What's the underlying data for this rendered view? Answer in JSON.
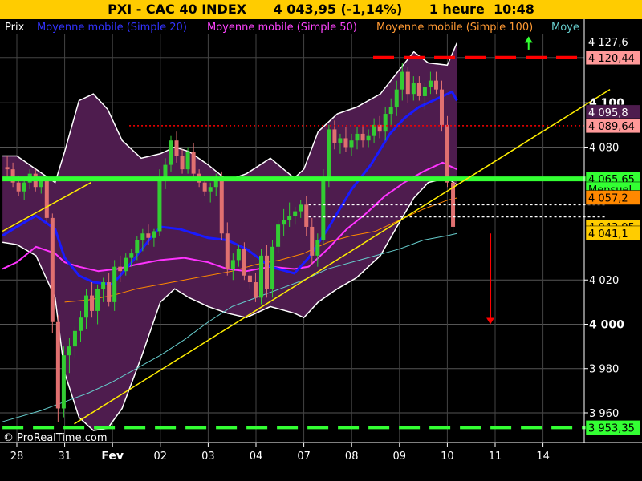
{
  "title": "PXI - CAC 40 INDEX      4 043,95 (-1,14%)      1 heure  10:48",
  "legend": {
    "prix": "Prix",
    "ma20": "Moyenne mobile (Simple 20)",
    "ma50": "Moyenne mobile (Simple 50)",
    "ma100": "Moyenne mobile (Simple 100)",
    "ma_cut": "Moye"
  },
  "watermark": "© ProRealTime.com",
  "colors": {
    "background": "#000000",
    "title_bg": "#ffcc00",
    "bollinger_fill": "#4e1c4e",
    "bollinger_edge": "#ffffff",
    "up_candle": "#33cc33",
    "down_candle": "#e07070",
    "ma20": "#1a1aff",
    "ma50": "#ff33ff",
    "ma100": "#ff8800",
    "ma200": "#66cccc",
    "trendline": "#ffee00",
    "support": "#33ff33",
    "resistance": "#ff0000"
  },
  "chart_data": {
    "type": "candlestick",
    "timeframe": "1 heure",
    "instrument": "PXI - CAC 40 INDEX",
    "last": "4 043,95",
    "change": "-1,14%",
    "ylim": [
      3951,
      4133
    ],
    "y_ticks": [
      {
        "label": "3 960",
        "value": 3960,
        "bold": false
      },
      {
        "label": "3 980",
        "value": 3980,
        "bold": false
      },
      {
        "label": "4 000",
        "value": 4000,
        "bold": true
      },
      {
        "label": "4 020",
        "value": 4020,
        "bold": false
      },
      {
        "label": "4 080",
        "value": 4080,
        "bold": false
      },
      {
        "label": "4 100",
        "value": 4100,
        "bold": true
      }
    ],
    "x_labels": [
      {
        "label": "28",
        "pos": 0,
        "bold": false
      },
      {
        "label": "31",
        "pos": 1,
        "bold": false
      },
      {
        "label": "Fev",
        "pos": 2,
        "bold": true
      },
      {
        "label": "02",
        "pos": 3,
        "bold": false
      },
      {
        "label": "03",
        "pos": 4,
        "bold": false
      },
      {
        "label": "04",
        "pos": 5,
        "bold": false
      },
      {
        "label": "07",
        "pos": 6,
        "bold": false
      },
      {
        "label": "08",
        "pos": 7,
        "bold": false
      },
      {
        "label": "09",
        "pos": 8,
        "bold": false
      },
      {
        "label": "10",
        "pos": 9,
        "bold": false
      },
      {
        "label": "11",
        "pos": 10,
        "bold": false
      },
      {
        "label": "14",
        "pos": 11,
        "bold": false
      }
    ],
    "price_labels": [
      {
        "text": "4 127,6",
        "value": 4127.6,
        "bg": "#000000",
        "fg": "#ffffff"
      },
      {
        "text": "4 120,44",
        "value": 4120.44,
        "bg": "#ff9999",
        "fg": "#000000"
      },
      {
        "text": "4 095,8",
        "value": 4095.8,
        "bg": "#4e1c4e",
        "fg": "#ffffff"
      },
      {
        "text": "4 089,64",
        "value": 4089.64,
        "bg": "#ff9999",
        "fg": "#000000"
      },
      {
        "text": "4 065,65",
        "value": 4065.65,
        "bg": "#33ff33",
        "fg": "#000000"
      },
      {
        "text": "Mensuel",
        "value": 4061.0,
        "bg": "#33ff33",
        "fg": "#000000"
      },
      {
        "text": "4 057,2",
        "value": 4057.2,
        "bg": "#ff8800",
        "fg": "#000000"
      },
      {
        "text": "4 043,95",
        "value": 4043.95,
        "bg": "#ffcc00",
        "fg": "#000000"
      },
      {
        "text": "4 041,1",
        "value": 4041.1,
        "bg": "#ffcc00",
        "fg": "#000000"
      },
      {
        "text": "3 953,35",
        "value": 3953.35,
        "bg": "#33ff33",
        "fg": "#000000"
      }
    ],
    "levels": [
      {
        "name": "resistance",
        "value": 4120.44,
        "style": "dashed-thick",
        "color": "#ff0000",
        "from_pos": 7.45,
        "to_pos": 12.3
      },
      {
        "name": "pivot",
        "value": 4089.64,
        "style": "dotted",
        "color": "#ff0000",
        "from_pos": 2.35,
        "to_pos": 12.3
      },
      {
        "name": "monthly",
        "value": 4065.65,
        "style": "solid-thick",
        "color": "#33ff33",
        "from_pos": -0.3,
        "to_pos": 12.3
      },
      {
        "name": "gap-high",
        "value": 4054,
        "style": "dotted-white",
        "color": "#ffffff",
        "from_pos": 6.1,
        "to_pos": 12.3
      },
      {
        "name": "gap-low",
        "value": 4048.5,
        "style": "dotted-white",
        "color": "#ffffff",
        "from_pos": 6.1,
        "to_pos": 12.3
      },
      {
        "name": "support",
        "value": 3953.35,
        "style": "dashed-thick",
        "color": "#33ff33",
        "from_pos": -0.3,
        "to_pos": 12.3
      }
    ],
    "trendlines": [
      {
        "name": "lower-trend",
        "points": [
          [
            1.2,
            3955
          ],
          [
            12.4,
            4106
          ]
        ]
      },
      {
        "name": "early-trend",
        "points": [
          [
            -0.3,
            4042
          ],
          [
            1.55,
            4064
          ]
        ]
      }
    ],
    "arrows": [
      {
        "name": "down-arrow",
        "pos": 9.9,
        "from": 4041,
        "to": 4000,
        "color": "#ff0000"
      },
      {
        "name": "up-arrow",
        "pos": 10.7,
        "from": 4124,
        "to": 4130,
        "color": "#33ff33"
      }
    ],
    "candles": [
      [
        4071,
        4076,
        4066,
        4070
      ],
      [
        4070,
        4073,
        4062,
        4064
      ],
      [
        4064,
        4067,
        4058,
        4060
      ],
      [
        4060,
        4066,
        4056,
        4064
      ],
      [
        4064,
        4070,
        4061,
        4068
      ],
      [
        4068,
        4070,
        4060,
        4062
      ],
      [
        4062,
        4066,
        4059,
        4065
      ],
      [
        4065,
        4066,
        4046,
        4048
      ],
      [
        4048,
        4050,
        3996,
        4001
      ],
      [
        4001,
        4004,
        3956,
        3962
      ],
      [
        3962,
        3990,
        3958,
        3986
      ],
      [
        3986,
        3994,
        3978,
        3990
      ],
      [
        3990,
        3999,
        3985,
        3997
      ],
      [
        3997,
        4006,
        3992,
        4003
      ],
      [
        4003,
        4016,
        3998,
        4013
      ],
      [
        4013,
        4019,
        4003,
        4006
      ],
      [
        4006,
        4018,
        4000,
        4016
      ],
      [
        4016,
        4021,
        4010,
        4019
      ],
      [
        4019,
        4023,
        4008,
        4010
      ],
      [
        4010,
        4029,
        4006,
        4026
      ],
      [
        4026,
        4031,
        4019,
        4024
      ],
      [
        4024,
        4032,
        4022,
        4030
      ],
      [
        4030,
        4034,
        4026,
        4032
      ],
      [
        4032,
        4040,
        4029,
        4038
      ],
      [
        4038,
        4043,
        4033,
        4041
      ],
      [
        4041,
        4045,
        4036,
        4039
      ],
      [
        4039,
        4043,
        4035,
        4042
      ],
      [
        4042,
        4070,
        4040,
        4066
      ],
      [
        4066,
        4075,
        4061,
        4072
      ],
      [
        4072,
        4085,
        4069,
        4083
      ],
      [
        4083,
        4087,
        4073,
        4076
      ],
      [
        4076,
        4079,
        4068,
        4070
      ],
      [
        4070,
        4080,
        4068,
        4078
      ],
      [
        4078,
        4082,
        4066,
        4068
      ],
      [
        4068,
        4070,
        4062,
        4064
      ],
      [
        4064,
        4066,
        4058,
        4060
      ],
      [
        4060,
        4064,
        4055,
        4062
      ],
      [
        4062,
        4068,
        4058,
        4066
      ],
      [
        4066,
        4069,
        4038,
        4041
      ],
      [
        4041,
        4046,
        4022,
        4025
      ],
      [
        4025,
        4032,
        4020,
        4029
      ],
      [
        4029,
        4036,
        4026,
        4034
      ],
      [
        4034,
        4037,
        4020,
        4022
      ],
      [
        4022,
        4026,
        4016,
        4019
      ],
      [
        4019,
        4023,
        4010,
        4012
      ],
      [
        4012,
        4034,
        4009,
        4031
      ],
      [
        4031,
        4036,
        4012,
        4016
      ],
      [
        4016,
        4038,
        4012,
        4035
      ],
      [
        4035,
        4047,
        4032,
        4045
      ],
      [
        4045,
        4052,
        4040,
        4047
      ],
      [
        4047,
        4055,
        4044,
        4049
      ],
      [
        4049,
        4053,
        4045,
        4051
      ],
      [
        4051,
        4056,
        4048,
        4054
      ],
      [
        4054,
        4058,
        4040,
        4044
      ],
      [
        4044,
        4048,
        4027,
        4031
      ],
      [
        4031,
        4041,
        4026,
        4038
      ],
      [
        4038,
        4070,
        4036,
        4065
      ],
      [
        4065,
        4090,
        4062,
        4088
      ],
      [
        4088,
        4092,
        4079,
        4082
      ],
      [
        4082,
        4086,
        4077,
        4084
      ],
      [
        4084,
        4089,
        4078,
        4080
      ],
      [
        4080,
        4086,
        4076,
        4083
      ],
      [
        4083,
        4089,
        4079,
        4086
      ],
      [
        4086,
        4090,
        4080,
        4083
      ],
      [
        4083,
        4088,
        4080,
        4085
      ],
      [
        4085,
        4093,
        4082,
        4090
      ],
      [
        4090,
        4094,
        4084,
        4087
      ],
      [
        4087,
        4098,
        4083,
        4095
      ],
      [
        4095,
        4102,
        4090,
        4098
      ],
      [
        4098,
        4110,
        4094,
        4106
      ],
      [
        4106,
        4118,
        4101,
        4114
      ],
      [
        4114,
        4116,
        4100,
        4104
      ],
      [
        4104,
        4112,
        4101,
        4109
      ],
      [
        4109,
        4112,
        4101,
        4103
      ],
      [
        4103,
        4109,
        4097,
        4107
      ],
      [
        4107,
        4114,
        4104,
        4110
      ],
      [
        4110,
        4114,
        4104,
        4106
      ],
      [
        4106,
        4110,
        4087,
        4090
      ],
      [
        4090,
        4094,
        4062,
        4064
      ],
      [
        4064,
        4066,
        4041,
        4044
      ]
    ],
    "bollinger_upper": [
      [
        -0.3,
        4076
      ],
      [
        0.0,
        4076
      ],
      [
        0.4,
        4070
      ],
      [
        0.8,
        4064
      ],
      [
        1.0,
        4078
      ],
      [
        1.3,
        4101
      ],
      [
        1.6,
        4104
      ],
      [
        1.9,
        4097
      ],
      [
        2.2,
        4083
      ],
      [
        2.6,
        4075
      ],
      [
        3.0,
        4077
      ],
      [
        3.3,
        4080
      ],
      [
        3.6,
        4078
      ],
      [
        4.0,
        4072
      ],
      [
        4.4,
        4065
      ],
      [
        4.8,
        4068
      ],
      [
        5.3,
        4075
      ],
      [
        5.8,
        4066
      ],
      [
        6.0,
        4070
      ],
      [
        6.3,
        4087
      ],
      [
        6.7,
        4095
      ],
      [
        7.1,
        4098
      ],
      [
        7.6,
        4104
      ],
      [
        8.0,
        4115
      ],
      [
        8.3,
        4123
      ],
      [
        8.6,
        4118
      ],
      [
        9.0,
        4117
      ],
      [
        9.2,
        4127
      ]
    ],
    "bollinger_lower": [
      [
        -0.3,
        4037
      ],
      [
        0.0,
        4036
      ],
      [
        0.4,
        4031
      ],
      [
        0.8,
        4012
      ],
      [
        1.0,
        3978
      ],
      [
        1.3,
        3958
      ],
      [
        1.6,
        3952
      ],
      [
        1.9,
        3953
      ],
      [
        2.2,
        3962
      ],
      [
        2.6,
        3985
      ],
      [
        3.0,
        4010
      ],
      [
        3.3,
        4016
      ],
      [
        3.6,
        4012
      ],
      [
        4.0,
        4008
      ],
      [
        4.4,
        4005
      ],
      [
        4.8,
        4003
      ],
      [
        5.3,
        4008
      ],
      [
        5.8,
        4005
      ],
      [
        6.0,
        4003
      ],
      [
        6.3,
        4010
      ],
      [
        6.7,
        4016
      ],
      [
        7.1,
        4021
      ],
      [
        7.6,
        4031
      ],
      [
        8.0,
        4046
      ],
      [
        8.3,
        4057
      ],
      [
        8.6,
        4064
      ],
      [
        9.0,
        4066
      ],
      [
        9.2,
        4063
      ]
    ],
    "ma20": [
      [
        -0.3,
        4040
      ],
      [
        0.0,
        4044
      ],
      [
        0.4,
        4049
      ],
      [
        0.8,
        4043
      ],
      [
        1.0,
        4030
      ],
      [
        1.3,
        4022
      ],
      [
        1.6,
        4019
      ],
      [
        2.0,
        4018
      ],
      [
        2.4,
        4028
      ],
      [
        2.8,
        4039
      ],
      [
        3.0,
        4044
      ],
      [
        3.4,
        4043
      ],
      [
        3.7,
        4041
      ],
      [
        4.0,
        4039
      ],
      [
        4.4,
        4038
      ],
      [
        4.8,
        4034
      ],
      [
        5.3,
        4026
      ],
      [
        5.8,
        4023
      ],
      [
        6.1,
        4030
      ],
      [
        6.5,
        4043
      ],
      [
        7.0,
        4061
      ],
      [
        7.4,
        4072
      ],
      [
        7.8,
        4086
      ],
      [
        8.1,
        4093
      ],
      [
        8.4,
        4098
      ],
      [
        8.8,
        4102
      ],
      [
        9.1,
        4105
      ],
      [
        9.2,
        4101
      ]
    ],
    "ma50": [
      [
        -0.3,
        4025
      ],
      [
        0.0,
        4028
      ],
      [
        0.4,
        4035
      ],
      [
        0.8,
        4032
      ],
      [
        1.0,
        4028
      ],
      [
        1.3,
        4026
      ],
      [
        1.7,
        4024
      ],
      [
        2.1,
        4025
      ],
      [
        2.5,
        4027
      ],
      [
        3.0,
        4029
      ],
      [
        3.5,
        4030
      ],
      [
        4.0,
        4028
      ],
      [
        4.4,
        4025
      ],
      [
        4.8,
        4024
      ],
      [
        5.3,
        4026
      ],
      [
        5.8,
        4025
      ],
      [
        6.1,
        4026
      ],
      [
        6.5,
        4034
      ],
      [
        6.9,
        4043
      ],
      [
        7.3,
        4050
      ],
      [
        7.7,
        4058
      ],
      [
        8.1,
        4064
      ],
      [
        8.5,
        4069
      ],
      [
        8.9,
        4073
      ],
      [
        9.2,
        4070
      ]
    ],
    "ma100": [
      [
        1.0,
        4010
      ],
      [
        1.5,
        4011
      ],
      [
        2.0,
        4013
      ],
      [
        2.5,
        4016
      ],
      [
        3.0,
        4018
      ],
      [
        3.5,
        4020
      ],
      [
        4.0,
        4022
      ],
      [
        4.5,
        4024
      ],
      [
        5.0,
        4027
      ],
      [
        5.5,
        4029
      ],
      [
        6.0,
        4032
      ],
      [
        6.5,
        4037
      ],
      [
        7.0,
        4040
      ],
      [
        7.5,
        4042
      ],
      [
        8.0,
        4047
      ],
      [
        8.5,
        4052
      ],
      [
        9.0,
        4056
      ],
      [
        9.2,
        4057
      ]
    ],
    "ma200": [
      [
        -0.3,
        3956
      ],
      [
        0.5,
        3961
      ],
      [
        1.0,
        3965
      ],
      [
        1.5,
        3969
      ],
      [
        2.0,
        3974
      ],
      [
        2.5,
        3980
      ],
      [
        3.0,
        3986
      ],
      [
        3.5,
        3993
      ],
      [
        4.0,
        4001
      ],
      [
        4.5,
        4008
      ],
      [
        5.0,
        4012
      ],
      [
        5.5,
        4016
      ],
      [
        6.0,
        4020
      ],
      [
        6.5,
        4025
      ],
      [
        7.0,
        4028
      ],
      [
        7.5,
        4031
      ],
      [
        8.0,
        4034
      ],
      [
        8.5,
        4038
      ],
      [
        9.0,
        4040
      ],
      [
        9.2,
        4041
      ]
    ]
  }
}
